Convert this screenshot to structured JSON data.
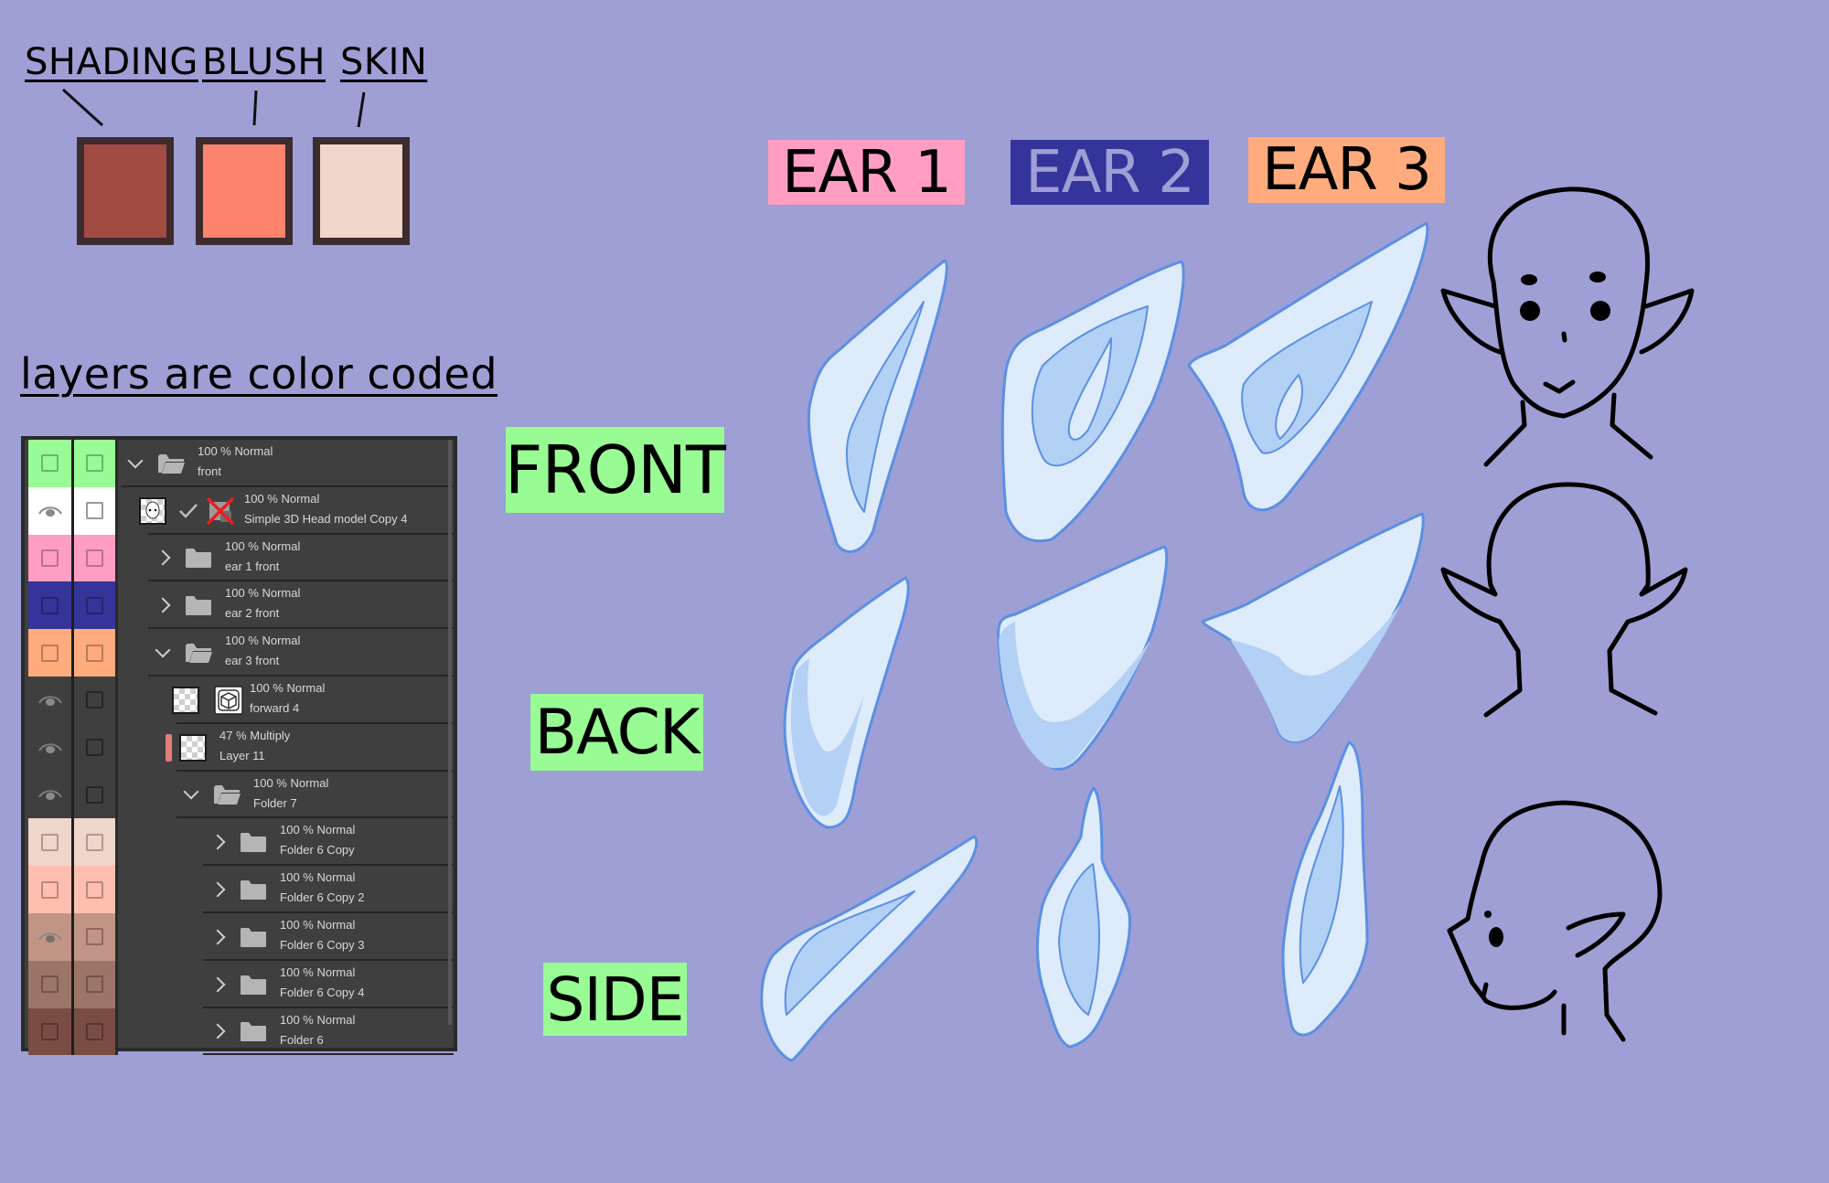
{
  "colors": {
    "background": "#9e9fd5",
    "swatch_shading": "#a14b42",
    "swatch_blush": "#ff846e",
    "swatch_skin": "#efd6ca",
    "view_label_bg": "#98fb94",
    "ear1_bg": "#ff9ec2",
    "ear2_bg": "#35349a",
    "ear3_bg": "#ffab7d",
    "ear_light": "#deebfb",
    "ear_mid": "#b3d0f5",
    "ear_outline": "#5b90e3"
  },
  "palette": {
    "items": [
      {
        "label": "SHADING",
        "color": "#a14b42"
      },
      {
        "label": "BLUSH",
        "color": "#ff846e"
      },
      {
        "label": "SKIN",
        "color": "#efd6ca"
      }
    ]
  },
  "layers_heading": "layers are color coded",
  "layer_panel": {
    "rows": [
      {
        "color": "#98fb94",
        "visible": false,
        "expander": "down",
        "icon": "folder-open-icon",
        "mode": "100 % Normal",
        "name": "front",
        "indent": 0
      },
      {
        "color": "#ffffff",
        "visible": true,
        "expander": "none",
        "icon": "3d-model-icon",
        "mode": "100 % Normal",
        "name": "Simple 3D Head model Copy 4",
        "indent": 1
      },
      {
        "color": "#ff9ec2",
        "visible": false,
        "expander": "right",
        "icon": "folder-icon",
        "mode": "100 % Normal",
        "name": "ear 1 front",
        "indent": 1
      },
      {
        "color": "#35349a",
        "visible": false,
        "expander": "right",
        "icon": "folder-icon",
        "mode": "100 % Normal",
        "name": "ear 2 front",
        "indent": 1
      },
      {
        "color": "#ffab7d",
        "visible": false,
        "expander": "down",
        "icon": "folder-open-icon",
        "mode": "100 % Normal",
        "name": "ear 3 front",
        "indent": 1
      },
      {
        "color": "",
        "visible": true,
        "expander": "none",
        "icon": "3d-camera-icon",
        "mode": "100 % Normal",
        "name": "forward 4",
        "indent": 2
      },
      {
        "color": "",
        "visible": true,
        "expander": "none",
        "icon": "raster-layer-icon",
        "mode": "47 % Multiply",
        "name": "Layer 11",
        "indent": 2
      },
      {
        "color": "",
        "visible": true,
        "expander": "down",
        "icon": "folder-open-icon",
        "mode": "100 % Normal",
        "name": "Folder 7",
        "indent": 2
      },
      {
        "color": "#efd6ca",
        "visible": false,
        "expander": "right",
        "icon": "folder-icon",
        "mode": "100 % Normal",
        "name": "Folder 6 Copy",
        "indent": 3
      },
      {
        "color": "#ffbfae",
        "visible": false,
        "expander": "right",
        "icon": "folder-icon",
        "mode": "100 % Normal",
        "name": "Folder 6 Copy 2",
        "indent": 3
      },
      {
        "color": "#c19585",
        "visible": true,
        "expander": "right",
        "icon": "folder-icon",
        "mode": "100 % Normal",
        "name": "Folder 6 Copy 3",
        "indent": 3
      },
      {
        "color": "#9d7568",
        "visible": false,
        "expander": "right",
        "icon": "folder-icon",
        "mode": "100 % Normal",
        "name": "Folder 6 Copy 4",
        "indent": 3
      },
      {
        "color": "#7a4d44",
        "visible": false,
        "expander": "right",
        "icon": "folder-icon",
        "mode": "100 % Normal",
        "name": "Folder 6",
        "indent": 3
      }
    ]
  },
  "view_labels": {
    "front": "FRONT",
    "back": "BACK",
    "side": "SIDE"
  },
  "ear_labels": [
    {
      "text": "EAR 1",
      "bg": "#ff9ec2",
      "fg": "#000000"
    },
    {
      "text": "EAR 2",
      "bg": "#35349a",
      "fg": "#9e9fd5"
    },
    {
      "text": "EAR 3",
      "bg": "#ffab7d",
      "fg": "#000000"
    }
  ]
}
